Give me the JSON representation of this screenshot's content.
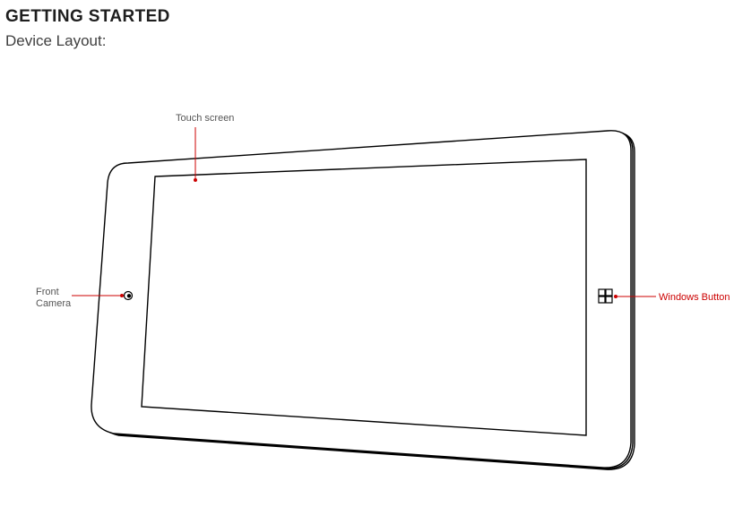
{
  "heading": "GETTING STARTED",
  "subtitle": "Device Layout:",
  "labels": {
    "touch_screen": "Touch screen",
    "front_camera_l1": "Front",
    "front_camera_l2": "Camera",
    "windows_button": "Windows Button"
  }
}
